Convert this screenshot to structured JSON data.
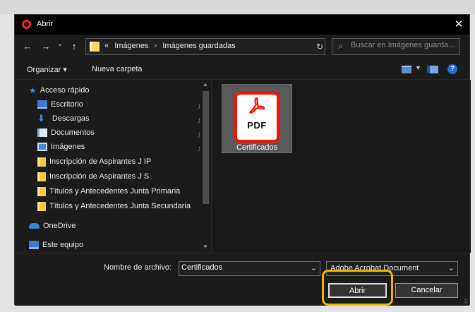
{
  "window": {
    "title": "Abrir",
    "close_glyph": "✕"
  },
  "nav": {
    "back_glyph": "←",
    "forward_glyph": "→",
    "recent_glyph": "⌄",
    "up_glyph": "↑",
    "refresh_glyph": "↻",
    "dropdown_glyph": "⌄",
    "breadcrumb_prefix": "«",
    "breadcrumb_sep": "›",
    "breadcrumb": [
      "Imágenes",
      "Imágenes guardadas"
    ]
  },
  "search": {
    "placeholder": "Buscar en Imágenes guarda..."
  },
  "toolbar": {
    "organize_label": "Organizar ▾",
    "new_folder_label": "Nueva carpeta",
    "help_glyph": "?"
  },
  "sidebar": {
    "pin_glyph": "📌",
    "items": [
      {
        "label": "Acceso rápido",
        "icon": "star-icon"
      },
      {
        "label": "Escritorio",
        "icon": "desktop-icon"
      },
      {
        "label": "Descargas",
        "icon": "downloads-icon"
      },
      {
        "label": "Documentos",
        "icon": "documents-icon"
      },
      {
        "label": "Imágenes",
        "icon": "pictures-icon"
      },
      {
        "label": "Inscripción de Aspirantes J IP",
        "icon": "folder-icon"
      },
      {
        "label": "Inscripción de Aspirantes J S",
        "icon": "folder-icon"
      },
      {
        "label": "Títulos y Antecedentes Junta Primaria",
        "icon": "folder-icon"
      },
      {
        "label": "Títulos y Antecedentes Junta Secundaria",
        "icon": "folder-icon"
      },
      {
        "label": "OneDrive",
        "icon": "onedrive-icon"
      },
      {
        "label": "Este equipo",
        "icon": "this-pc-icon"
      }
    ]
  },
  "files": [
    {
      "name": "Certificados",
      "badge": "PDF",
      "icon": "pdf-file-icon"
    }
  ],
  "footer": {
    "filename_label": "Nombre de archivo:",
    "filename_value": "Certificados",
    "filetype_value": "Adobe Acrobat Document",
    "open_label": "Abrir",
    "cancel_label": "Cancelar"
  },
  "colors": {
    "highlight": "#f0b400",
    "pdf_red": "#fa0f00",
    "opera_red": "#ff1b2d"
  }
}
